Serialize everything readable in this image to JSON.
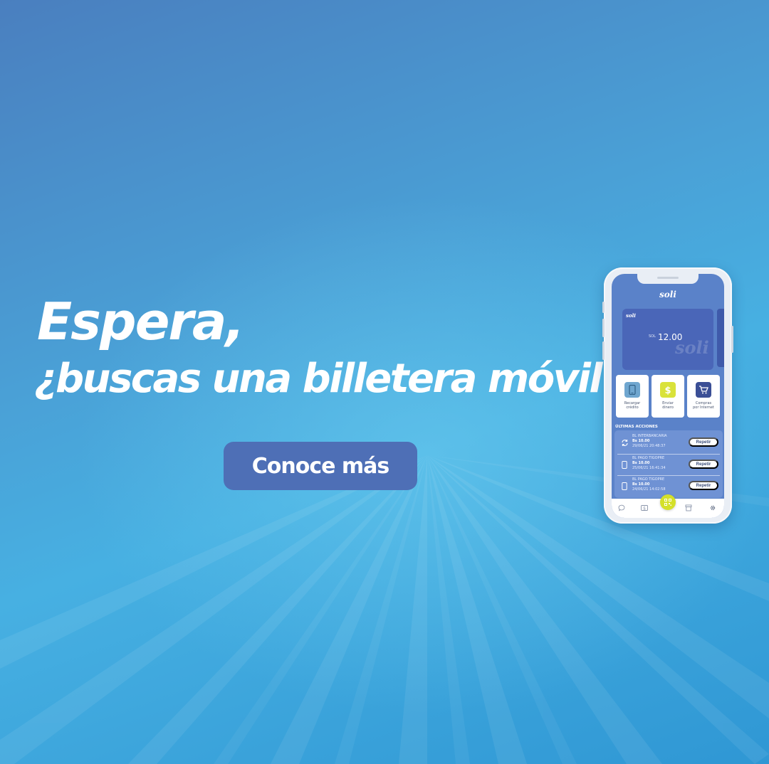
{
  "headline": {
    "line1": "Espera,",
    "line2": "¿buscas una billetera móvil?"
  },
  "cta": {
    "label": "Conoce más"
  },
  "phone": {
    "app_logo": "soli",
    "card": {
      "logo": "soli",
      "currency": "SOL",
      "amount": "12.00",
      "watermark": "soli"
    },
    "quick_actions": [
      {
        "label_line1": "Recargar",
        "label_line2": "crédito",
        "icon": "phone-icon"
      },
      {
        "label_line1": "Enviar",
        "label_line2": "dinero",
        "icon": "dollar-icon"
      },
      {
        "label_line1": "Compras",
        "label_line2": "por Internet",
        "icon": "cart-icon"
      }
    ],
    "recent_title": "ÚLTIMAS ACCIONES",
    "recent_actions": [
      {
        "title": "BL INTERBANCARIA",
        "amount": "Bs 10.00",
        "date": "29/06/21 20:48:37",
        "button": "Repetir",
        "icon": "refresh-icon"
      },
      {
        "title": "BL PAGO TIGOPRE",
        "amount": "Bs 10.00",
        "date": "25/06/21 16:41:34",
        "button": "Repetir",
        "icon": "phone-icon"
      },
      {
        "title": "BL PAGO TIGOPRE",
        "amount": "Bs 10.00",
        "date": "24/06/21 14:02:58",
        "button": "Repetir",
        "icon": "phone-icon"
      }
    ]
  },
  "colors": {
    "cta_bg": "#4e6fb6",
    "screen_bg": "#5a82c9",
    "card_bg": "#4a66b8",
    "qr_accent": "#d4e02a",
    "dollar_icon": "#d9e23a",
    "cart_icon": "#3b4f96",
    "phone_icon": "#6fa6cf"
  }
}
